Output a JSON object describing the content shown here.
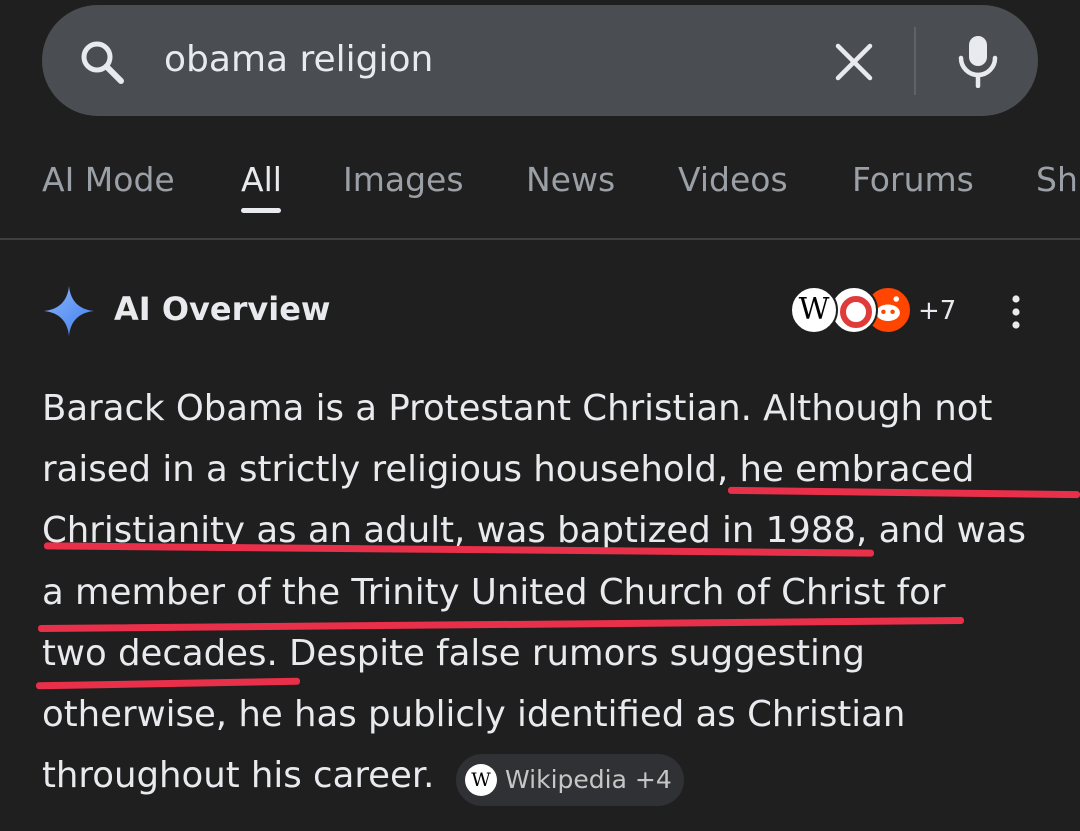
{
  "search": {
    "query": "obama religion"
  },
  "tabs": [
    {
      "label": "AI Mode",
      "active": false
    },
    {
      "label": "All",
      "active": true
    },
    {
      "label": "Images",
      "active": false
    },
    {
      "label": "News",
      "active": false
    },
    {
      "label": "Videos",
      "active": false
    },
    {
      "label": "Forums",
      "active": false
    },
    {
      "label": "Sh",
      "active": false
    }
  ],
  "overview": {
    "title": "AI Overview",
    "sources_more": "+7",
    "favicons": [
      "W"
    ],
    "lines": [
      "Barack Obama is a Protestant Christian. Although not",
      "raised in a strictly religious household, he embraced",
      "Christianity as an adult, was baptized in 1988, and was",
      "a member of the Trinity United Church of Christ for",
      "two decades. Despite false rumors suggesting",
      "otherwise, he has publicly identified as Christian",
      "throughout his career."
    ],
    "source_chip": {
      "icon": "W",
      "label": "Wikipedia +4"
    }
  },
  "colors": {
    "background": "#1f1f1f",
    "search_bar": "#4a4d51",
    "highlight_underline": "#e8304a",
    "ai_sparkle": "#4f8df7"
  },
  "icons": [
    "search-icon",
    "clear-icon",
    "mic-icon",
    "ai-sparkle-icon",
    "more-vert-icon",
    "wikipedia-icon",
    "reddit-icon"
  ]
}
